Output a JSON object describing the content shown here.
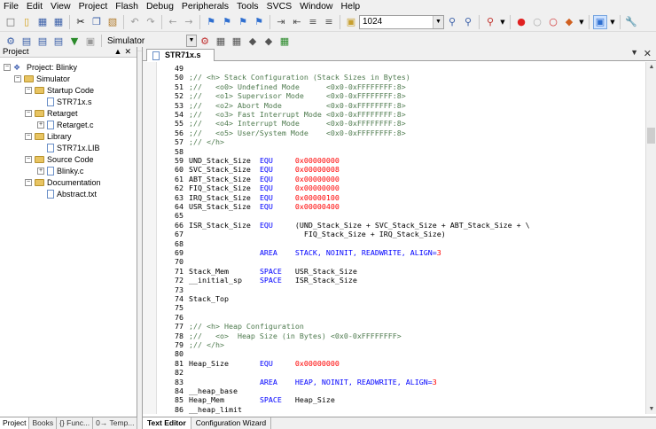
{
  "menu": [
    "File",
    "Edit",
    "View",
    "Project",
    "Flash",
    "Debug",
    "Peripherals",
    "Tools",
    "SVCS",
    "Window",
    "Help"
  ],
  "toolbar": {
    "value_field": "1024",
    "target_name": "Simulator"
  },
  "project": {
    "title": "Project",
    "tree": [
      {
        "label": "Project: Blinky",
        "level": 0,
        "type": "project",
        "toggle": "−"
      },
      {
        "label": "Simulator",
        "level": 1,
        "type": "folder",
        "toggle": "−"
      },
      {
        "label": "Startup Code",
        "level": 2,
        "type": "folder",
        "toggle": "−"
      },
      {
        "label": "STR71x.s",
        "level": 3,
        "type": "file",
        "toggle": ""
      },
      {
        "label": "Retarget",
        "level": 2,
        "type": "folder",
        "toggle": "−"
      },
      {
        "label": "Retarget.c",
        "level": 3,
        "type": "file",
        "toggle": "+"
      },
      {
        "label": "Library",
        "level": 2,
        "type": "folder",
        "toggle": "−"
      },
      {
        "label": "STR71x.LIB",
        "level": 3,
        "type": "file",
        "toggle": ""
      },
      {
        "label": "Source Code",
        "level": 2,
        "type": "folder",
        "toggle": "−"
      },
      {
        "label": "Blinky.c",
        "level": 3,
        "type": "file",
        "toggle": "+"
      },
      {
        "label": "Documentation",
        "level": 2,
        "type": "folder",
        "toggle": "−"
      },
      {
        "label": "Abstract.txt",
        "level": 3,
        "type": "file",
        "toggle": ""
      }
    ],
    "tabs": [
      "Project",
      "Books",
      "{} Func...",
      "0→ Temp..."
    ]
  },
  "editor": {
    "tab": "STR71x.s",
    "bottom_tabs": [
      "Text Editor",
      "Configuration Wizard"
    ],
    "lines": [
      {
        "n": "49",
        "s": []
      },
      {
        "n": "50",
        "s": [
          [
            "c",
            ";// <h> Stack Configuration (Stack Sizes in Bytes)"
          ]
        ]
      },
      {
        "n": "51",
        "s": [
          [
            "c",
            ";//   <o0> Undefined Mode      <0x0-0xFFFFFFFF:8>"
          ]
        ]
      },
      {
        "n": "52",
        "s": [
          [
            "c",
            ";//   <o1> Supervisor Mode     <0x0-0xFFFFFFFF:8>"
          ]
        ]
      },
      {
        "n": "53",
        "s": [
          [
            "c",
            ";//   <o2> Abort Mode          <0x0-0xFFFFFFFF:8>"
          ]
        ]
      },
      {
        "n": "54",
        "s": [
          [
            "c",
            ";//   <o3> Fast Interrupt Mode <0x0-0xFFFFFFFF:8>"
          ]
        ]
      },
      {
        "n": "55",
        "s": [
          [
            "c",
            ";//   <o4> Interrupt Mode      <0x0-0xFFFFFFFF:8>"
          ]
        ]
      },
      {
        "n": "56",
        "s": [
          [
            "c",
            ";//   <o5> User/System Mode    <0x0-0xFFFFFFFF:8>"
          ]
        ]
      },
      {
        "n": "57",
        "s": [
          [
            "c",
            ";// </h>"
          ]
        ]
      },
      {
        "n": "58",
        "s": []
      },
      {
        "n": "59",
        "s": [
          [
            "t",
            "UND_Stack_Size  "
          ],
          [
            "kw",
            "EQU"
          ],
          [
            "t",
            "     "
          ],
          [
            "num",
            "0x00000000"
          ]
        ]
      },
      {
        "n": "60",
        "s": [
          [
            "t",
            "SVC_Stack_Size  "
          ],
          [
            "kw",
            "EQU"
          ],
          [
            "t",
            "     "
          ],
          [
            "num",
            "0x00000008"
          ]
        ]
      },
      {
        "n": "61",
        "s": [
          [
            "t",
            "ABT_Stack_Size  "
          ],
          [
            "kw",
            "EQU"
          ],
          [
            "t",
            "     "
          ],
          [
            "num",
            "0x00000000"
          ]
        ]
      },
      {
        "n": "62",
        "s": [
          [
            "t",
            "FIQ_Stack_Size  "
          ],
          [
            "kw",
            "EQU"
          ],
          [
            "t",
            "     "
          ],
          [
            "num",
            "0x00000000"
          ]
        ]
      },
      {
        "n": "63",
        "s": [
          [
            "t",
            "IRQ_Stack_Size  "
          ],
          [
            "kw",
            "EQU"
          ],
          [
            "t",
            "     "
          ],
          [
            "num",
            "0x00000100"
          ]
        ]
      },
      {
        "n": "64",
        "s": [
          [
            "t",
            "USR_Stack_Size  "
          ],
          [
            "kw",
            "EQU"
          ],
          [
            "t",
            "     "
          ],
          [
            "num",
            "0x00000400"
          ]
        ]
      },
      {
        "n": "65",
        "s": []
      },
      {
        "n": "66",
        "s": [
          [
            "t",
            "ISR_Stack_Size  "
          ],
          [
            "kw",
            "EQU"
          ],
          [
            "t",
            "     (UND_Stack_Size + SVC_Stack_Size + ABT_Stack_Size + \\"
          ]
        ]
      },
      {
        "n": "67",
        "s": [
          [
            "t",
            "                          FIQ_Stack_Size + IRQ_Stack_Size)"
          ]
        ]
      },
      {
        "n": "68",
        "s": []
      },
      {
        "n": "69",
        "s": [
          [
            "t",
            "                "
          ],
          [
            "kw",
            "AREA"
          ],
          [
            "t",
            "    "
          ],
          [
            "kw",
            "STACK, NOINIT, READWRITE, ALIGN="
          ],
          [
            "num",
            "3"
          ]
        ]
      },
      {
        "n": "70",
        "s": []
      },
      {
        "n": "71",
        "s": [
          [
            "t",
            "Stack_Mem       "
          ],
          [
            "kw",
            "SPACE"
          ],
          [
            "t",
            "   USR_Stack_Size"
          ]
        ]
      },
      {
        "n": "72",
        "s": [
          [
            "t",
            "__initial_sp    "
          ],
          [
            "kw",
            "SPACE"
          ],
          [
            "t",
            "   ISR_Stack_Size"
          ]
        ]
      },
      {
        "n": "73",
        "s": []
      },
      {
        "n": "74",
        "s": [
          [
            "t",
            "Stack_Top"
          ]
        ]
      },
      {
        "n": "75",
        "s": []
      },
      {
        "n": "76",
        "s": []
      },
      {
        "n": "77",
        "s": [
          [
            "c",
            ";// <h> Heap Configuration"
          ]
        ]
      },
      {
        "n": "78",
        "s": [
          [
            "c",
            ";//   <o>  Heap Size (in Bytes) <0x0-0xFFFFFFFF>"
          ]
        ]
      },
      {
        "n": "79",
        "s": [
          [
            "c",
            ";// </h>"
          ]
        ]
      },
      {
        "n": "80",
        "s": []
      },
      {
        "n": "81",
        "s": [
          [
            "t",
            "Heap_Size       "
          ],
          [
            "kw",
            "EQU"
          ],
          [
            "t",
            "     "
          ],
          [
            "num",
            "0x00000000"
          ]
        ]
      },
      {
        "n": "82",
        "s": []
      },
      {
        "n": "83",
        "s": [
          [
            "t",
            "                "
          ],
          [
            "kw",
            "AREA"
          ],
          [
            "t",
            "    "
          ],
          [
            "kw",
            "HEAP, NOINIT, READWRITE, ALIGN="
          ],
          [
            "num",
            "3"
          ]
        ]
      },
      {
        "n": "84",
        "s": [
          [
            "t",
            "__heap_base"
          ]
        ]
      },
      {
        "n": "85",
        "s": [
          [
            "t",
            "Heap_Mem        "
          ],
          [
            "kw",
            "SPACE"
          ],
          [
            "t",
            "   Heap_Size"
          ]
        ]
      },
      {
        "n": "86",
        "s": [
          [
            "t",
            "__heap_limit"
          ]
        ]
      }
    ]
  },
  "colors": {
    "comment": "#4e7a4e",
    "keyword": "#0000ff",
    "number": "#ff0000"
  }
}
